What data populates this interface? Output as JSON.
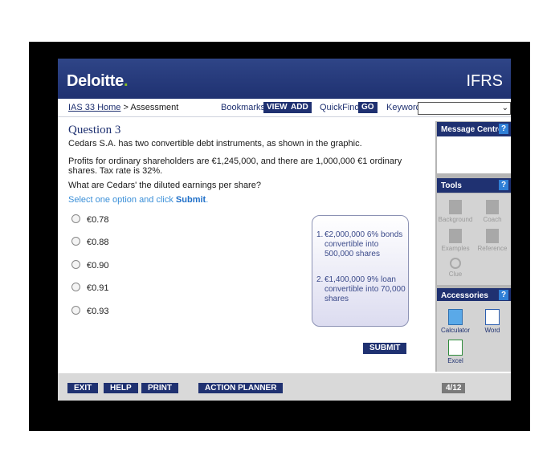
{
  "header": {
    "brand": "Deloitte",
    "brand_dot": ".",
    "product": "IFRS"
  },
  "nav": {
    "home_link": "IAS 33 Home",
    "separator": " > ",
    "current": "Assessment",
    "bookmarks_label": "Bookmarks:",
    "view_label": "VIEW",
    "add_label": "ADD",
    "quickfind_label": "QuickFind:",
    "go_label": "GO",
    "keyword_label": "Keyword:",
    "keyword_value": ""
  },
  "question": {
    "title": "Question 3",
    "p1": "Cedars S.A. has two convertible debt instruments, as shown in the graphic.",
    "p2": "Profits for ordinary shareholders are €1,245,000, and there are 1,000,000 €1 ordinary shares. Tax rate is 32%.",
    "p3": "What are Cedars' the diluted earnings per share?",
    "instruction_pre": "Select one option and click ",
    "instruction_action": "Submit",
    "instruction_post": ".",
    "options": [
      "€0.78",
      "€0.88",
      "€0.90",
      "€0.91",
      "€0.93"
    ],
    "submit_label": "SUBMIT"
  },
  "graphic": {
    "items": [
      {
        "num": "1.",
        "text": "€2,000,000 6% bonds convertible into 500,000 shares"
      },
      {
        "num": "2.",
        "text": "€1,400,000 9% loan convertible into 70,000 shares"
      }
    ]
  },
  "panel": {
    "message_centre": "Message Centre",
    "tools": "Tools",
    "accessories": "Accessories",
    "help_glyph": "?",
    "tool_items": [
      "Background",
      "Coach",
      "Examples",
      "Reference",
      "Clue"
    ],
    "accessory_items": [
      "Calculator",
      "Word",
      "Excel"
    ]
  },
  "footer": {
    "exit": "EXIT",
    "help": "HELP",
    "print": "PRINT",
    "action_planner": "ACTION PLANNER",
    "page_indicator": "4/12"
  },
  "colors": {
    "navy": "#1f3171",
    "accent_blue": "#3a8fd8",
    "deloitte_green": "#86bc25"
  }
}
